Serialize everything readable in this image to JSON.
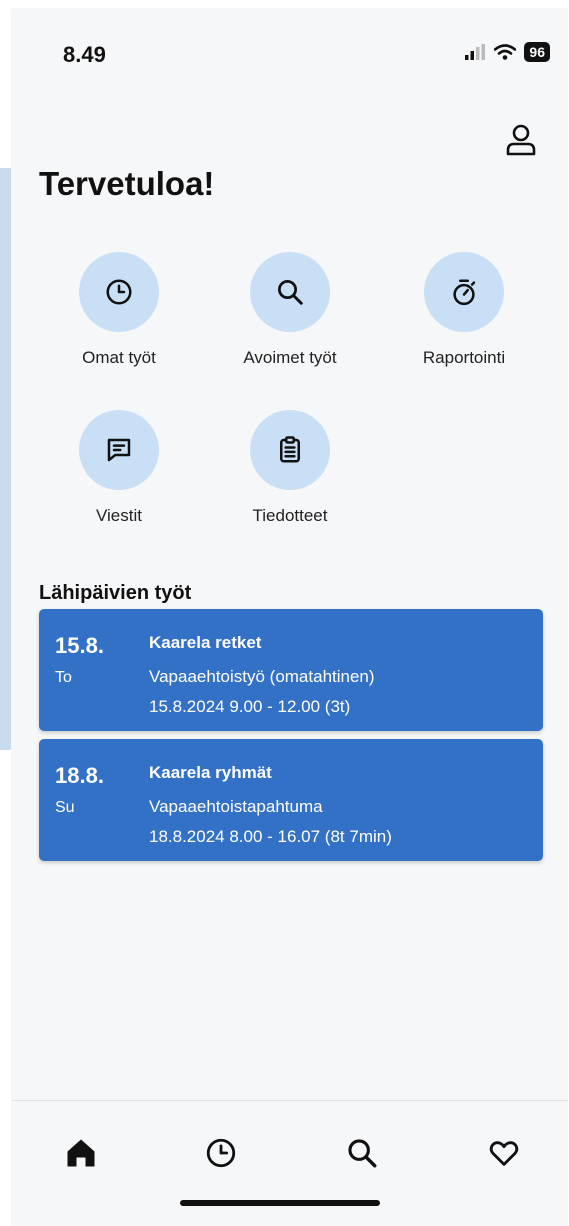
{
  "status_bar": {
    "time": "8.49",
    "battery": "96"
  },
  "header": {
    "title": "Tervetuloa!"
  },
  "quick_actions": [
    {
      "label": "Omat työt",
      "icon": "clock-icon"
    },
    {
      "label": "Avoimet työt",
      "icon": "search-icon"
    },
    {
      "label": "Raportointi",
      "icon": "stopwatch-icon"
    },
    {
      "label": "Viestit",
      "icon": "message-icon"
    },
    {
      "label": "Tiedotteet",
      "icon": "clipboard-icon"
    }
  ],
  "upcoming": {
    "title": "Lähipäivien työt",
    "items": [
      {
        "date": "15.8.",
        "weekday": "To",
        "title": "Kaarela retket",
        "type": "Vapaaehtoistyö (omatahtinen)",
        "time": "15.8.2024 9.00 - 12.00 (3t)"
      },
      {
        "date": "18.8.",
        "weekday": "Su",
        "title": "Kaarela ryhmät",
        "type": "Vapaaehtoistapahtuma",
        "time": "18.8.2024 8.00 - 16.07 (8t 7min)"
      }
    ]
  },
  "bottom_nav": [
    {
      "icon": "home-icon",
      "active": true
    },
    {
      "icon": "clock-icon"
    },
    {
      "icon": "search-icon"
    },
    {
      "icon": "heart-icon"
    }
  ],
  "colors": {
    "accent": "#3371c7",
    "chip": "#c9dff5",
    "background": "#f6f7f9"
  }
}
